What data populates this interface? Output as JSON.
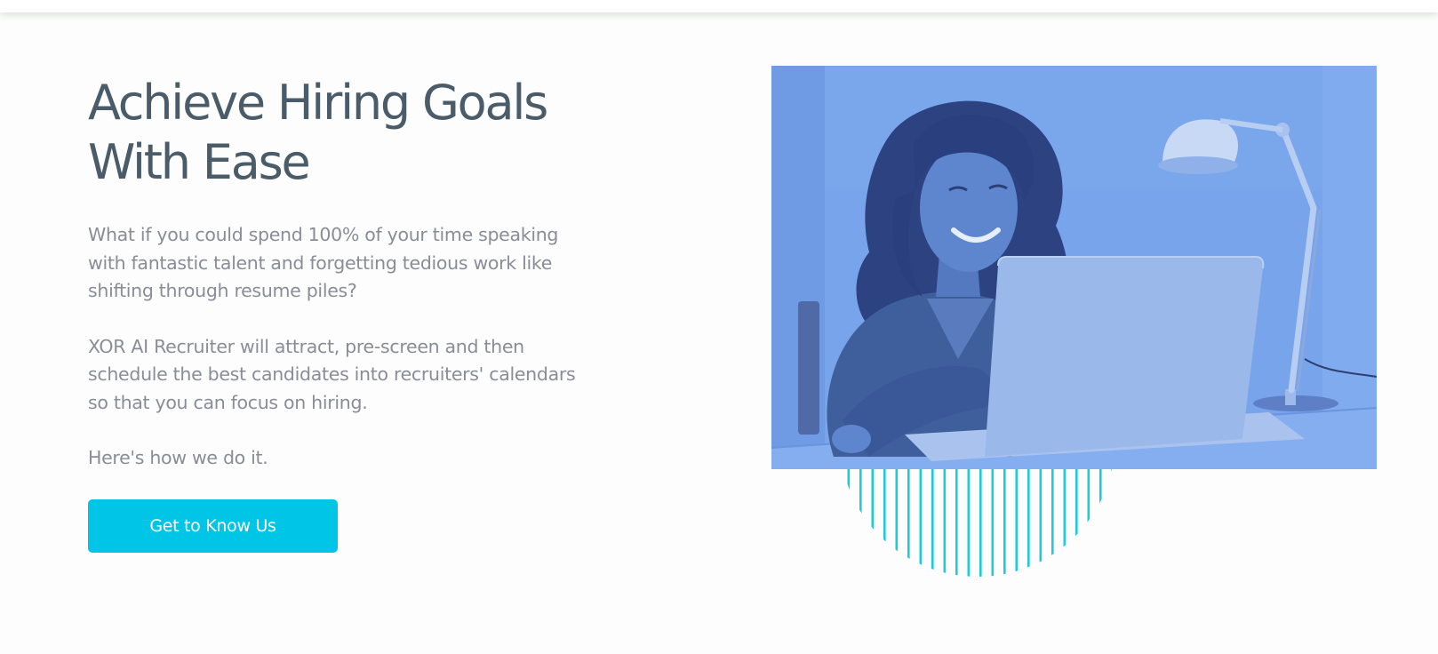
{
  "hero": {
    "headline_line1": "Achieve Hiring Goals",
    "headline_line2": "With Ease",
    "paragraph_1": "What if you could spend 100% of your time speaking with fantastic talent and forgetting tedious work like shifting through resume piles?",
    "paragraph_2": "XOR AI Recruiter will attract, pre-screen and then schedule the best candidates into recruiters' calendars so that you can focus on hiring.",
    "paragraph_3": "Here's how we do it.",
    "cta_label": "Get to Know Us"
  },
  "colors": {
    "accent": "#00c5e6",
    "headline": "#4a5b69",
    "body_text": "#8a8c98",
    "photo_tint": "#76a3ea",
    "background": "#fcfdfc"
  },
  "image": {
    "subject": "woman smiling at laptop beside desk lamp, blue-tinted photo"
  }
}
